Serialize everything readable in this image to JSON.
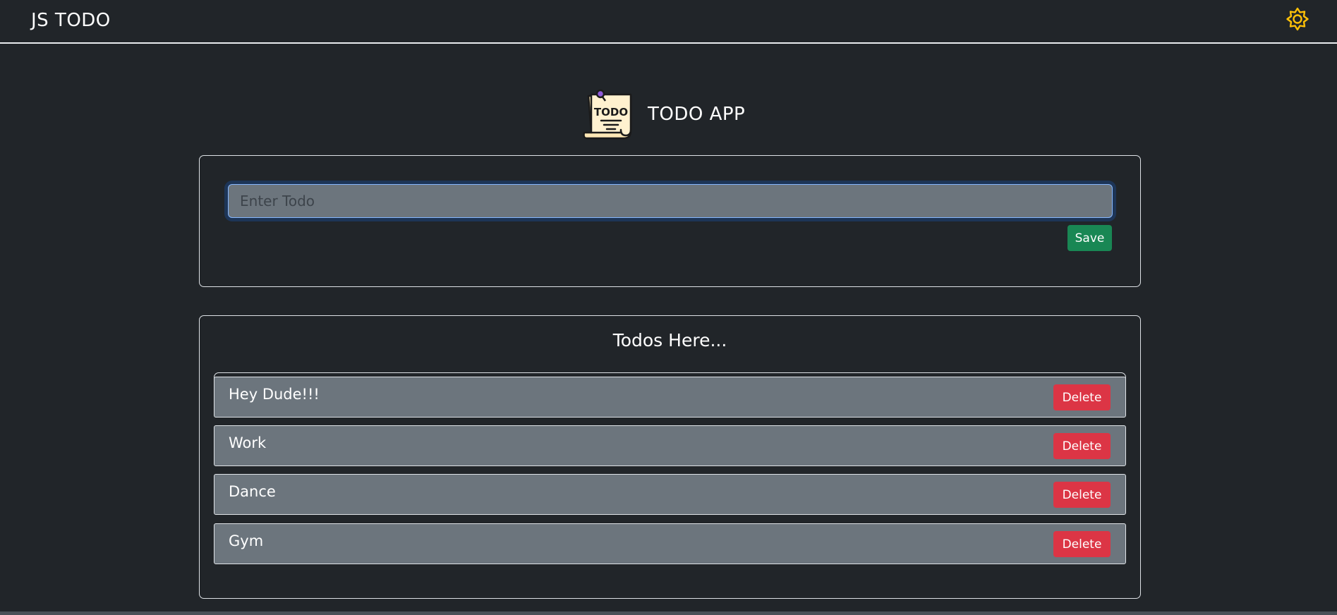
{
  "navbar": {
    "brand": "JS TODO",
    "theme_icon": "sun-gear-icon",
    "theme_icon_color": "#ffc107"
  },
  "hero": {
    "logo_icon": "todo-note-icon",
    "logo_text": "TODO",
    "title": "TODO APP"
  },
  "input_card": {
    "placeholder": "Enter Todo",
    "value": "",
    "save_label": "Save"
  },
  "list_card": {
    "title": "Todos Here...",
    "items": [
      {
        "text": "Hey Dude!!!",
        "delete_label": "Delete"
      },
      {
        "text": "Work",
        "delete_label": "Delete"
      },
      {
        "text": "Dance",
        "delete_label": "Delete"
      },
      {
        "text": "Gym",
        "delete_label": "Delete"
      }
    ]
  },
  "colors": {
    "background": "#212529",
    "item_background": "#6c757d",
    "save_button": "#198754",
    "delete_button": "#dc3545",
    "accent": "#ffc107"
  }
}
